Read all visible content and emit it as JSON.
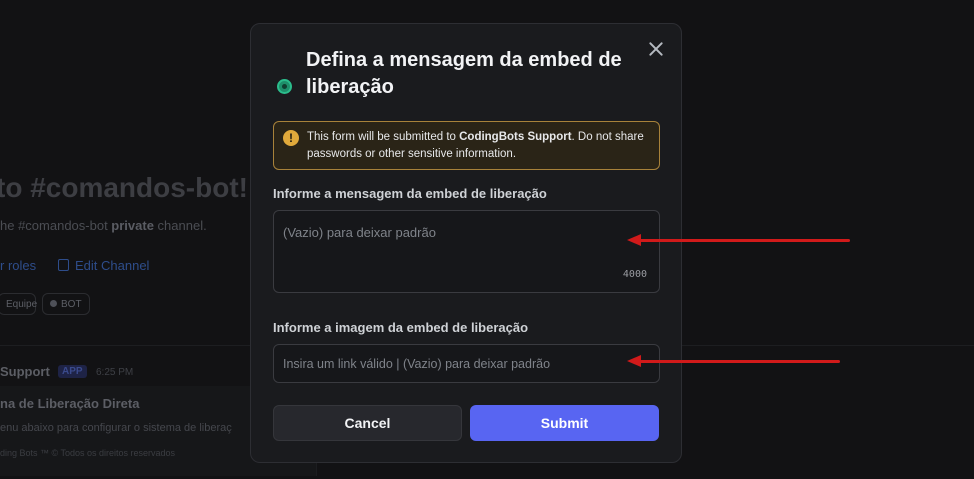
{
  "background": {
    "welcome_title": "to #comandos-bot!",
    "welcome_sub_prefix": "he #comandos-bot ",
    "welcome_sub_bold": "private",
    "welcome_sub_suffix": " channel.",
    "roles_link": "r roles",
    "edit_channel_link": "Edit Channel",
    "tag_equipe": "Equipe",
    "tag_bot": "BOT",
    "author": "Support",
    "app_badge": "APP",
    "time": "6:25 PM",
    "embed_title": "na de Liberação Direta",
    "embed_desc": "enu abaixo para configurar o sistema de liberaç",
    "embed_footer": "ding Bots ™ © Todos os direitos reservados"
  },
  "modal": {
    "title": "Defina a mensagem da embed de liberação",
    "icon": "app-avatar-icon",
    "close_icon": "close-icon",
    "warning": {
      "prefix": "This form will be submitted to ",
      "app_name": "CodingBots Support",
      "suffix": ". Do not share passwords or other sensitive information."
    },
    "fields": [
      {
        "label": "Informe a mensagem da embed de liberação",
        "placeholder": "(Vazio) para deixar padrão",
        "counter": "4000"
      },
      {
        "label": "Informe a imagem da embed de liberação",
        "placeholder": "Insira um link válido | (Vazio) para deixar padrão"
      }
    ],
    "cancel_label": "Cancel",
    "submit_label": "Submit"
  },
  "colors": {
    "accent": "#5865f2",
    "warning_border": "#a8823a",
    "annotation_arrow": "#d11a1a"
  }
}
